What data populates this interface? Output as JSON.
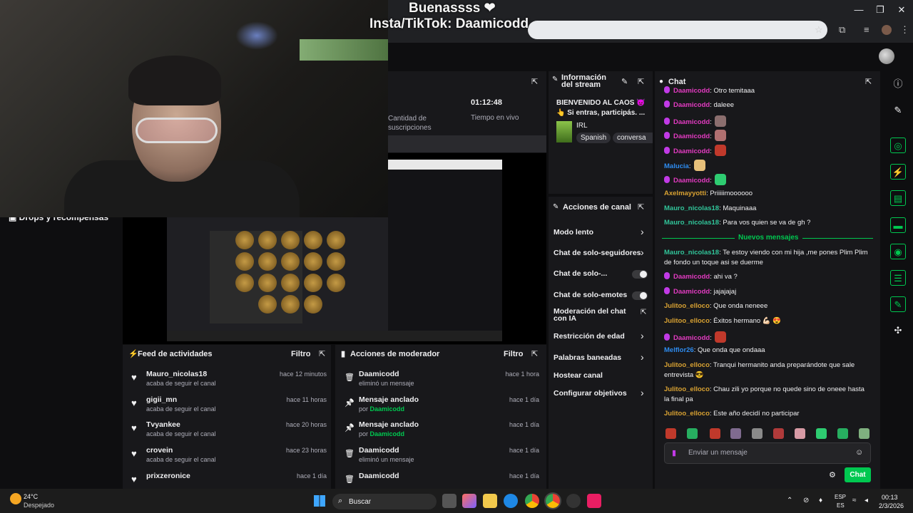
{
  "overlay": {
    "title": "Buenassss ❤",
    "subtitle": "Insta/TikTok: Daamicodd"
  },
  "sidebar": {
    "drops_label": "Drops y recompensas"
  },
  "stats": {
    "subs_label": "Cantidad de suscripciones",
    "live_time": "01:12:48",
    "live_label": "Tiempo en vivo"
  },
  "info": {
    "title": "Información del stream",
    "line1": "BIENVENIDO AL CAOS 👿",
    "line2": "👆 Si entras, participás. ...",
    "category": "IRL",
    "tags": [
      "Spanish",
      "conversa"
    ]
  },
  "canal": {
    "title": "Acciones de canal",
    "items": [
      "Modo lento",
      "Chat de solo-seguidores",
      "Chat de solo-...",
      "Chat de solo-emotes",
      "Moderación del chat con IA",
      "Restricción de edad",
      "Palabras baneadas",
      "Hostear canal",
      "Configurar objetivos"
    ]
  },
  "feed": {
    "title": "Feed de actividades",
    "filter": "Filtro",
    "rows": [
      {
        "user": "Mauro_nicolas18",
        "time": "hace 12 minutos",
        "desc": "acaba de seguir el canal"
      },
      {
        "user": "gigii_mn",
        "time": "hace 11 horas",
        "desc": "acaba de seguir el canal"
      },
      {
        "user": "Tvyankee",
        "time": "hace 20 horas",
        "desc": "acaba de seguir el canal"
      },
      {
        "user": "crovein",
        "time": "hace 23 horas",
        "desc": "acaba de seguir el canal"
      },
      {
        "user": "prixzeronice",
        "time": "hace 1 día",
        "desc": ""
      }
    ]
  },
  "mod": {
    "title": "Acciones de moderador",
    "filter": "Filtro",
    "rows": [
      {
        "title": "Daamicodd",
        "time": "hace 1 hora",
        "desc": "eliminó un mensaje",
        "by": ""
      },
      {
        "title": "Mensaje anclado",
        "time": "hace 1 día",
        "desc": "por ",
        "by": "Daamicodd"
      },
      {
        "title": "Mensaje anclado",
        "time": "hace 1 día",
        "desc": "por ",
        "by": "Daamicodd"
      },
      {
        "title": "Daamicodd",
        "time": "hace 1 día",
        "desc": "eliminó un mensaje",
        "by": ""
      },
      {
        "title": "Daamicodd",
        "time": "hace 1 día",
        "desc": "",
        "by": ""
      }
    ]
  },
  "chat": {
    "title": "Chat",
    "messages": [
      {
        "user": "Daamicodd",
        "text": ": Otro temitaaa",
        "color": "#e23bc0",
        "badge": true
      },
      {
        "user": "Daamicodd",
        "text": ": daleee",
        "color": "#e23bc0",
        "badge": true
      },
      {
        "user": "Daamicodd",
        "text": ":",
        "color": "#e23bc0",
        "badge": true
      },
      {
        "user": "Daamicodd",
        "text": ":",
        "color": "#e23bc0",
        "badge": true
      },
      {
        "user": "Daamicodd",
        "text": ":",
        "color": "#e23bc0",
        "badge": true
      },
      {
        "user": "Malucia",
        "text": ":",
        "color": "#2e8cf0",
        "badge": false
      },
      {
        "user": "Daamicodd",
        "text": ":",
        "color": "#e23bc0",
        "badge": true
      },
      {
        "user": "Axelmayyotti",
        "text": ": Priiiiimoooooo",
        "color": "#d9a232",
        "badge": false
      },
      {
        "user": "Mauro_nicolas18",
        "text": ": Maquinaaa",
        "color": "#31c59a",
        "badge": false
      },
      {
        "user": "Mauro_nicolas18",
        "text": ": Para vos quien se va de gh ?",
        "color": "#31c59a",
        "badge": false
      }
    ],
    "new_messages": "Nuevos mensajes",
    "messages2": [
      {
        "user": "Mauro_nicolas18",
        "text": ": Te estoy viendo con mi hija ,me pones Plim Plim de fondo un toque asi se duerme",
        "color": "#31c59a",
        "badge": false
      },
      {
        "user": "Daamicodd",
        "text": ": ahi va ?",
        "color": "#e23bc0",
        "badge": true
      },
      {
        "user": "Daamicodd",
        "text": ": jajajajaj",
        "color": "#e23bc0",
        "badge": true
      },
      {
        "user": "Julitoo_elloco",
        "text": ": Que onda neneee",
        "color": "#d9a232",
        "badge": false
      },
      {
        "user": "Julitoo_elloco",
        "text": ": Éxitos hermano 💪🏻 😍",
        "color": "#d9a232",
        "badge": false
      },
      {
        "user": "Daamicodd",
        "text": ":",
        "color": "#e23bc0",
        "badge": true
      },
      {
        "user": "Melflor26",
        "text": ": Que onda que ondaaa",
        "color": "#2e8cf0",
        "badge": false
      },
      {
        "user": "Julitoo_elloco",
        "text": ": Tranqui hermanito anda preparándote que sale entrevista 😎",
        "color": "#d9a232",
        "badge": false
      },
      {
        "user": "Julitoo_elloco",
        "text": ": Chau zili yo porque no quede sino de oneee hasta la final pa",
        "color": "#d9a232",
        "badge": false
      },
      {
        "user": "Julitoo_elloco",
        "text": ": Este año decidí no participar",
        "color": "#d9a232",
        "badge": false
      }
    ],
    "input_placeholder": "Enviar un mensaje",
    "send_label": "Chat"
  },
  "taskbar": {
    "temp": "24°C",
    "weather": "Despejado",
    "search": "Buscar",
    "lang1": "ESP",
    "lang2": "ES",
    "time": "00:13",
    "date": "2/3/2026"
  }
}
